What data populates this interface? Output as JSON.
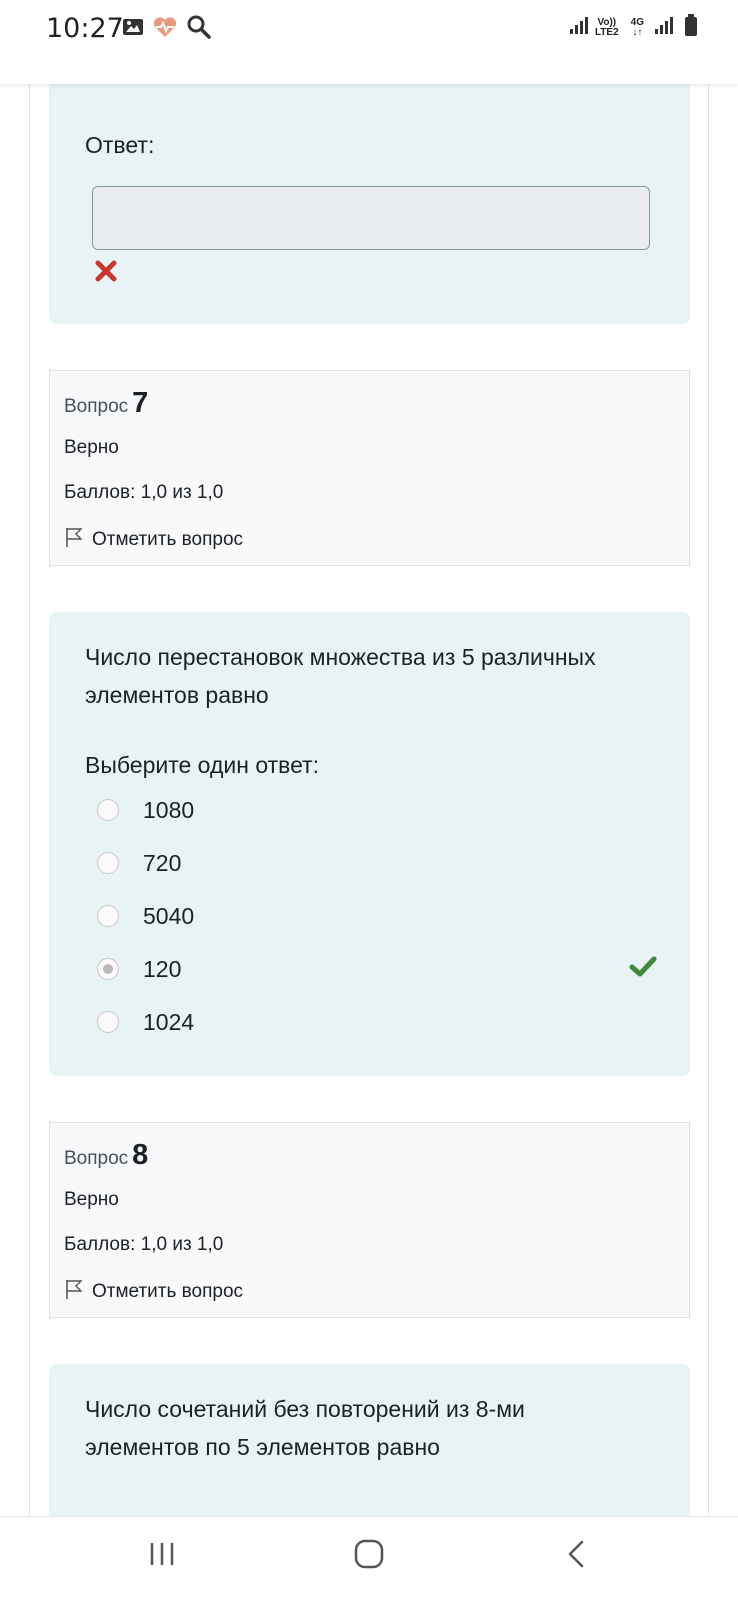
{
  "status_bar": {
    "time": "10:27",
    "icons": [
      "image-icon",
      "heart-rate-icon",
      "search-icon"
    ],
    "network": {
      "volte": "Vo))",
      "lte": "LTE2",
      "net": "4G"
    },
    "battery_icon": "battery-icon"
  },
  "prev_question": {
    "answer_label": "Ответ:",
    "answer_value": "",
    "result_icon": "cross-icon",
    "result_color": "#c8372d"
  },
  "question7": {
    "label": "Вопрос",
    "number": "7",
    "state": "Верно",
    "grade": "Баллов: 1,0 из 1,0",
    "flag_label": "Отметить вопрос",
    "text": "Число перестановок множества из 5 различных элементов равно",
    "prompt": "Выберите один ответ:",
    "options": [
      {
        "label": "1080",
        "checked": false
      },
      {
        "label": "720",
        "checked": false
      },
      {
        "label": "5040",
        "checked": false
      },
      {
        "label": "120",
        "checked": true
      },
      {
        "label": "1024",
        "checked": false
      }
    ],
    "correct_icon": "check-icon",
    "correct_color": "#3e8a3a"
  },
  "question8": {
    "label": "Вопрос",
    "number": "8",
    "state": "Верно",
    "grade": "Баллов: 1,0 из 1,0",
    "flag_label": "Отметить вопрос",
    "text": "Число сочетаний без повторений из 8-ми элементов по 5 элементов равно"
  },
  "nav_bar": {
    "buttons": [
      "recent-apps-icon",
      "home-icon",
      "back-icon"
    ]
  },
  "colors": {
    "question_bg": "#e7f3f5",
    "info_bg": "#f8f9fa"
  }
}
